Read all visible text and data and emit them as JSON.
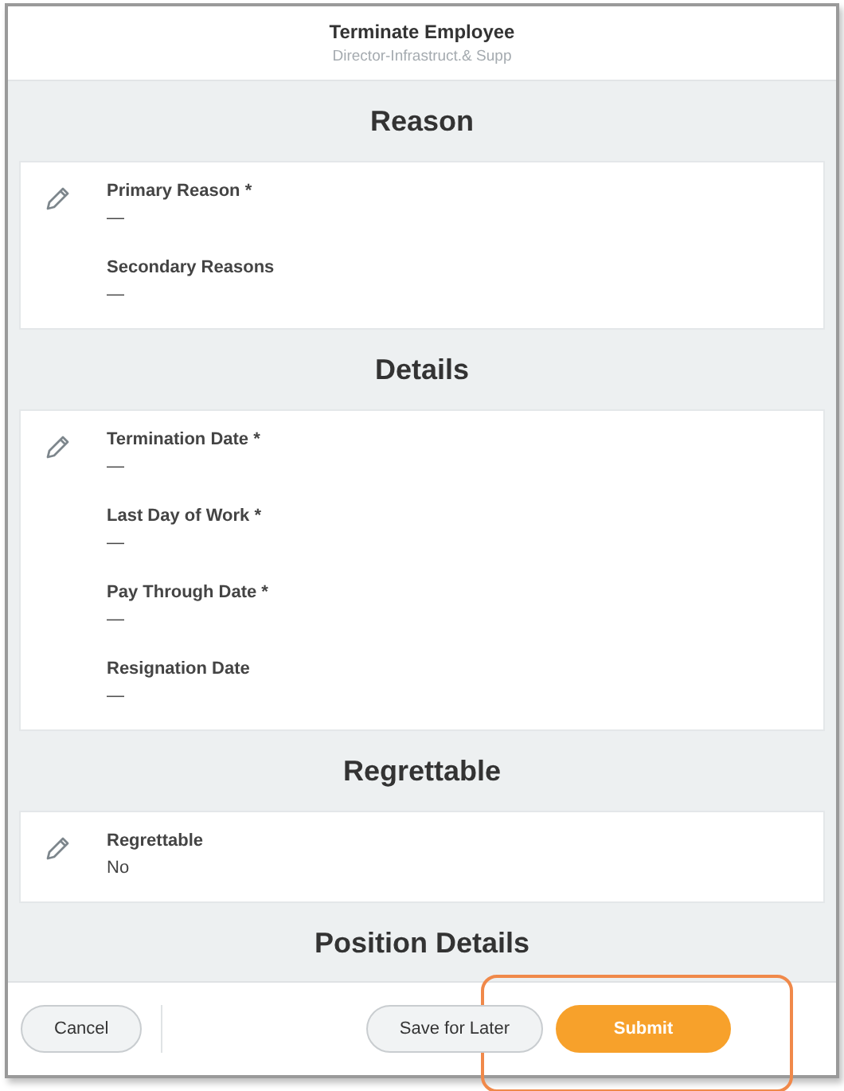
{
  "header": {
    "title": "Terminate Employee",
    "subtitle": "Director-Infrastruct.& Supp"
  },
  "sections": [
    {
      "title": "Reason",
      "fields": [
        {
          "label": "Primary Reason *",
          "value": "—"
        },
        {
          "label": "Secondary Reasons",
          "value": "—"
        }
      ]
    },
    {
      "title": "Details",
      "fields": [
        {
          "label": "Termination Date *",
          "value": "—"
        },
        {
          "label": "Last Day of Work *",
          "value": "—"
        },
        {
          "label": "Pay Through Date *",
          "value": "—"
        },
        {
          "label": "Resignation Date",
          "value": "—"
        }
      ]
    },
    {
      "title": "Regrettable",
      "fields": [
        {
          "label": "Regrettable",
          "value": "No"
        }
      ]
    },
    {
      "title": "Position Details"
    }
  ],
  "footer": {
    "buttons": [
      {
        "label": "Cancel",
        "kind": "secondary"
      },
      {
        "label": "Save for Later",
        "kind": "secondary"
      },
      {
        "label": "Submit",
        "kind": "primary"
      }
    ]
  }
}
